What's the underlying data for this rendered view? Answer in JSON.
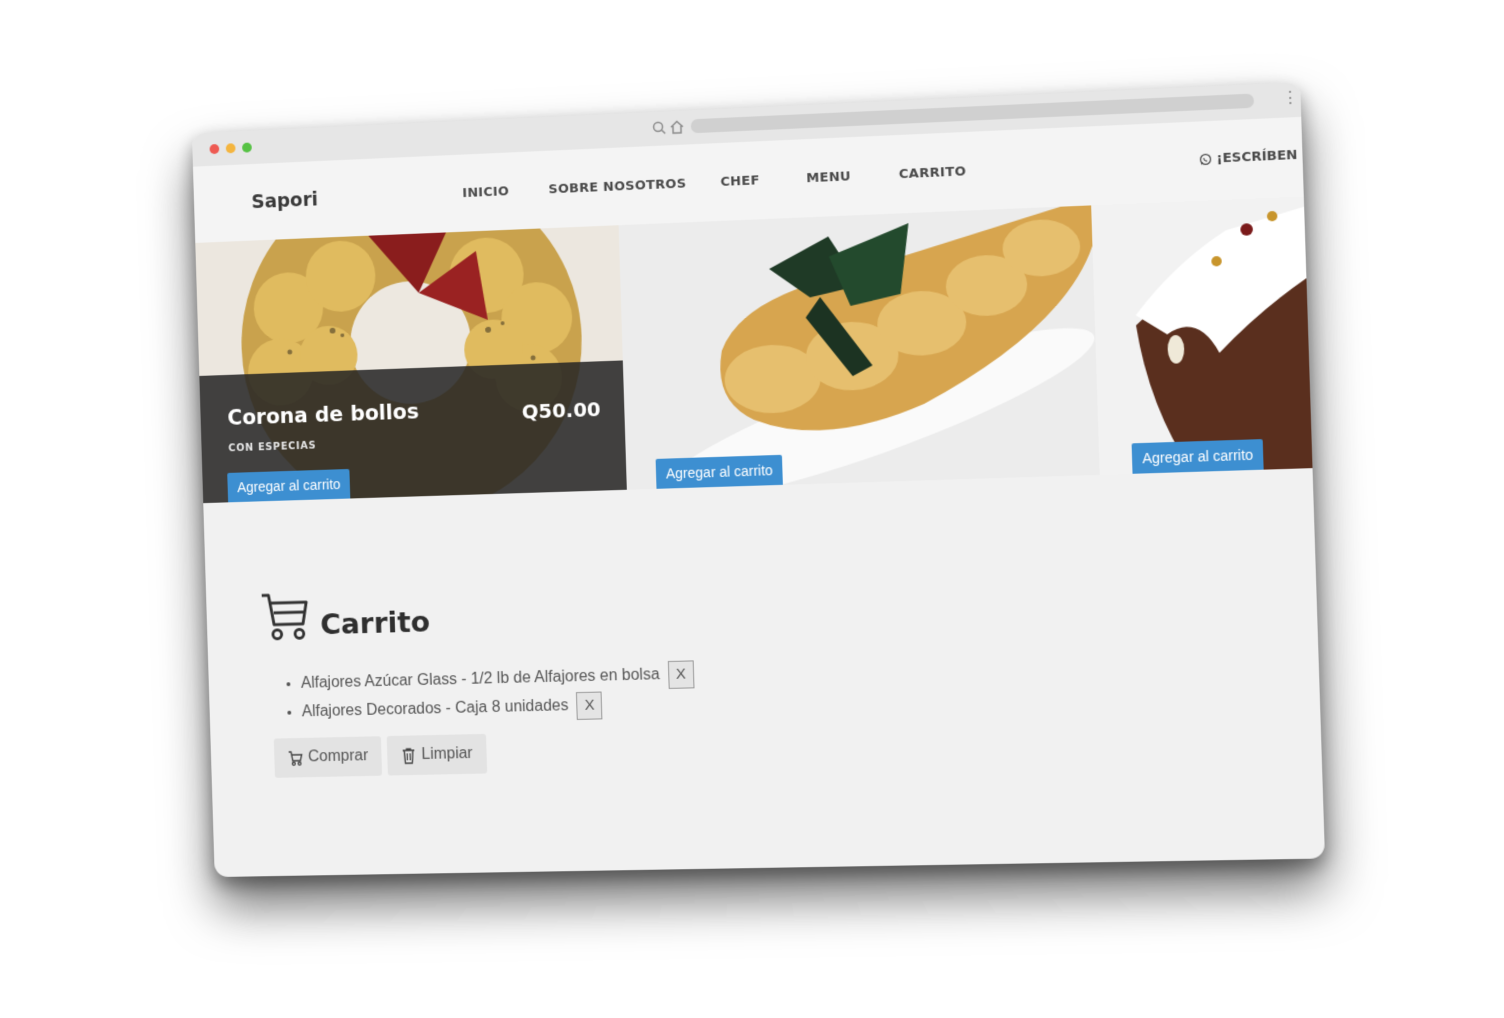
{
  "browser": {
    "icons": [
      "search-icon",
      "home-icon",
      "kebab-menu-icon"
    ]
  },
  "nav": {
    "brand": "Sapori",
    "items": [
      {
        "label": "INICIO"
      },
      {
        "label": "SOBRE NOSOTROS"
      },
      {
        "label": "CHEF"
      },
      {
        "label": "MENU"
      },
      {
        "label": "CARRITO"
      }
    ],
    "contact": "¡ESCRÍBEN"
  },
  "products": [
    {
      "title": "Corona de bollos",
      "subtitle": "CON ESPECIAS",
      "price": "Q50.00",
      "button": "Agregar al carrito"
    },
    {
      "button": "Agregar al carrito"
    },
    {
      "button": "Agregar al carrito"
    }
  ],
  "cart": {
    "title": "Carrito",
    "items": [
      {
        "text": "Alfajores Azúcar Glass - 1/2 lb de Alfajores en bolsa",
        "remove": "X"
      },
      {
        "text": "Alfajores Decorados - Caja 8 unidades",
        "remove": "X"
      }
    ],
    "buy_label": "Comprar",
    "clear_label": "Limpiar"
  },
  "colors": {
    "accent": "#3d8fd1",
    "overlay": "#242424",
    "page_bg": "#f1f1f1"
  }
}
